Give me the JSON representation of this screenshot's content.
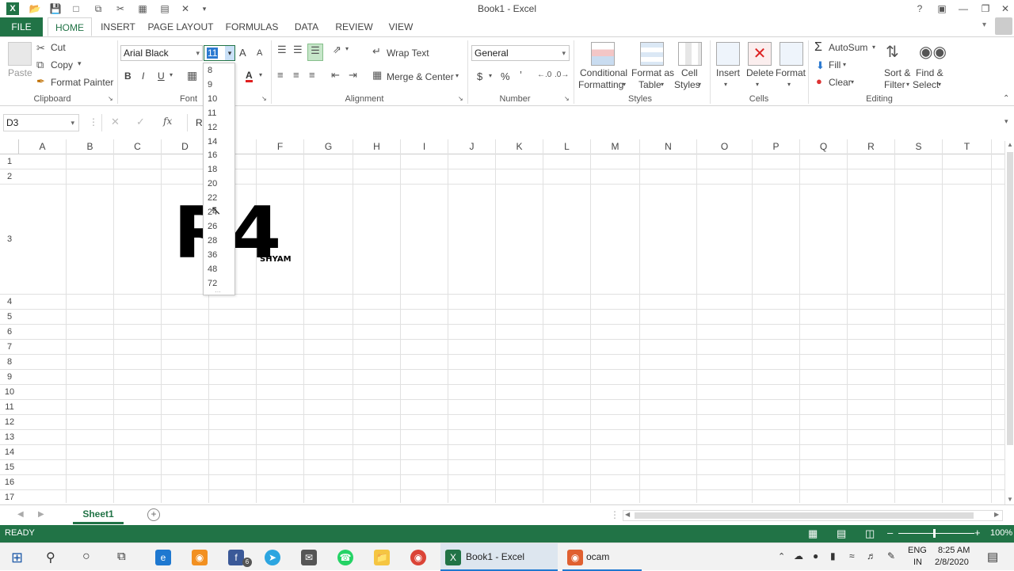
{
  "window": {
    "title": "Book1 - Excel"
  },
  "tabs": [
    "FILE",
    "HOME",
    "INSERT",
    "PAGE LAYOUT",
    "FORMULAS",
    "DATA",
    "REVIEW",
    "VIEW"
  ],
  "clipboard": {
    "cut": "Cut",
    "copy": "Copy",
    "paste": "Paste",
    "format_painter": "Format Painter",
    "label": "Clipboard"
  },
  "font": {
    "name": "Arial Black",
    "size": "11",
    "label": "Font",
    "bold": "B",
    "italic": "I",
    "underline": "U",
    "grow": "A",
    "shrink": "A",
    "color_a": "A"
  },
  "alignment": {
    "wrap": "Wrap Text",
    "merge": "Merge & Center",
    "label": "Alignment"
  },
  "number": {
    "format": "General",
    "currency": "$",
    "percent": "%",
    "comma": "’",
    "label": "Number"
  },
  "styles": {
    "conditional1": "Conditional",
    "conditional2": "Formatting",
    "format_as1": "Format as",
    "format_as2": "Table",
    "cell1": "Cell",
    "cell2": "Styles",
    "label": "Styles"
  },
  "cells": {
    "insert": "Insert",
    "delete": "Delete",
    "format": "Format",
    "label": "Cells"
  },
  "editing": {
    "autosum": "AutoSum",
    "fill": "Fill",
    "clear": "Clear",
    "sort1": "Sort &",
    "sort2": "Filter",
    "find1": "Find &",
    "find2": "Select",
    "label": "Editing"
  },
  "formula_bar": {
    "name_box": "D3",
    "fx": "fx",
    "content": "R"
  },
  "columns": [
    "A",
    "B",
    "C",
    "D",
    "E",
    "F",
    "G",
    "H",
    "I",
    "J",
    "K",
    "L",
    "M",
    "N",
    "O",
    "P",
    "Q",
    "R",
    "S",
    "T"
  ],
  "rows": [
    "1",
    "2",
    "3",
    "4",
    "5",
    "6",
    "7",
    "8",
    "9",
    "10",
    "11",
    "12",
    "13",
    "14",
    "15",
    "16",
    "17"
  ],
  "cell_content": {
    "big_text": "R4",
    "small_text": "SHYAM"
  },
  "font_sizes": [
    "8",
    "9",
    "10",
    "11",
    "12",
    "14",
    "16",
    "18",
    "20",
    "22",
    "24",
    "26",
    "28",
    "36",
    "48",
    "72"
  ],
  "sheet": {
    "name": "Sheet1"
  },
  "status": {
    "text": "READY",
    "zoom": "100%"
  },
  "taskbar": {
    "excel_app": "Book1 - Excel",
    "ocam_app": "ocam",
    "lang1": "ENG",
    "lang2": "IN",
    "time": "8:25 AM",
    "date": "2/8/2020",
    "badge": "6"
  }
}
